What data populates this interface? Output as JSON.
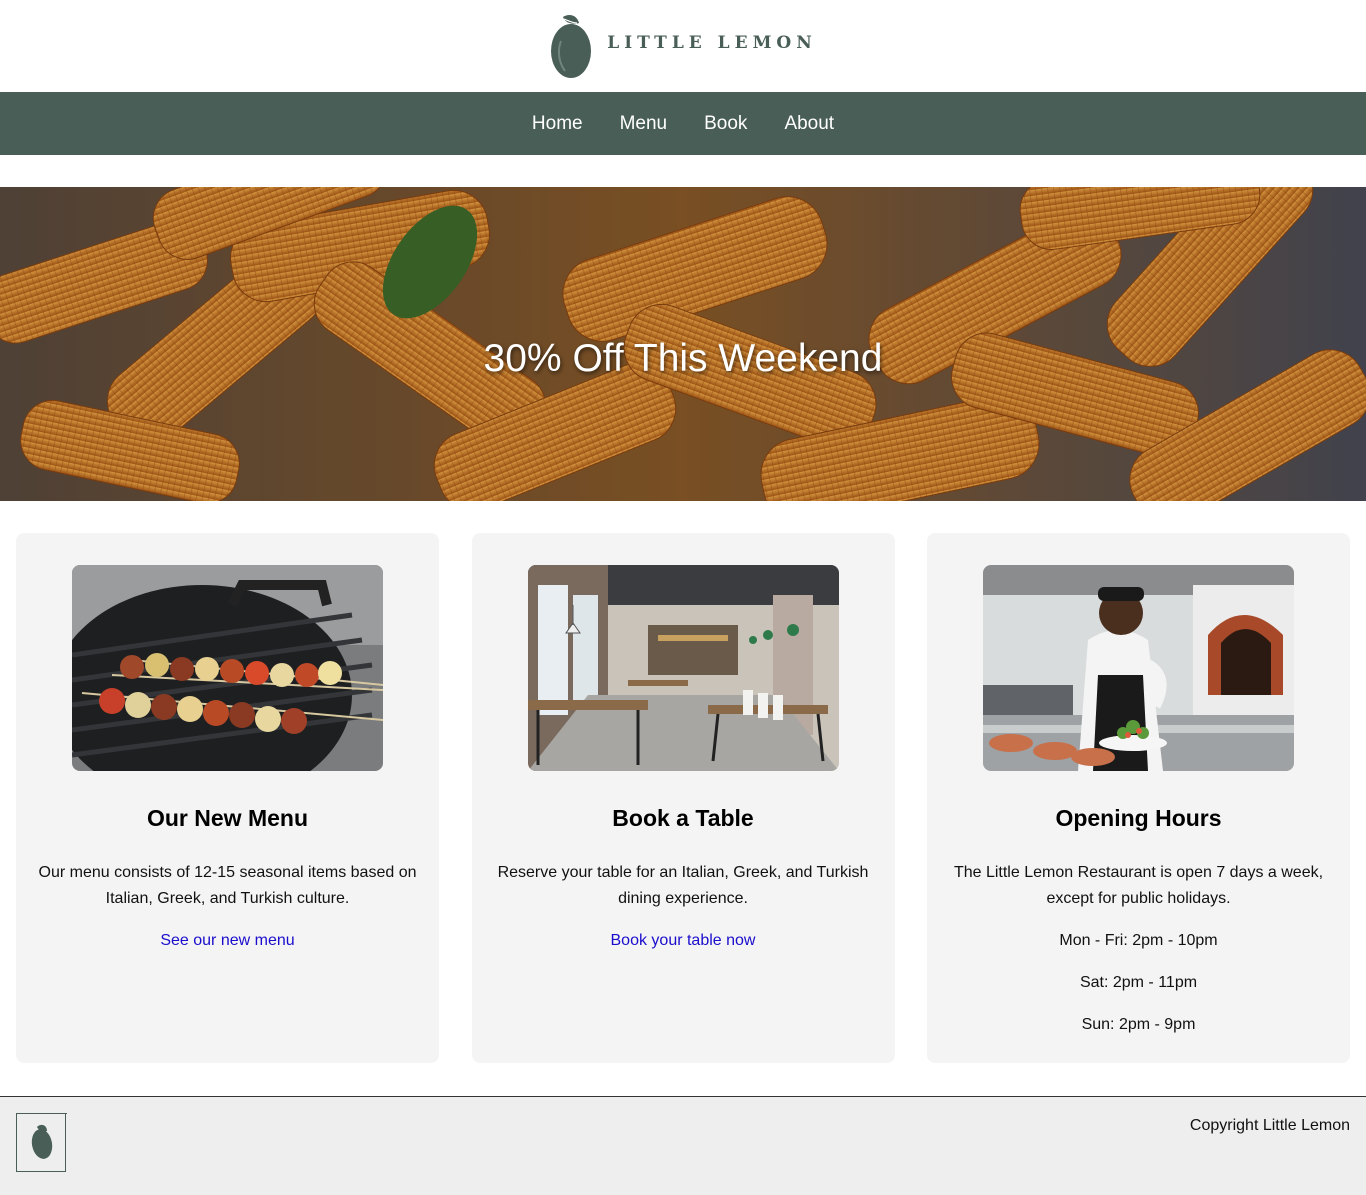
{
  "brand": {
    "name": "LITTLE LEMON",
    "color": "#495e57"
  },
  "nav": {
    "items": [
      {
        "label": "Home"
      },
      {
        "label": "Menu"
      },
      {
        "label": "Book"
      },
      {
        "label": "About"
      }
    ]
  },
  "hero": {
    "title": "30% Off This Weekend"
  },
  "cards": [
    {
      "title": "Our New Menu",
      "description": "Our menu consists of 12-15 seasonal items based on Italian, Greek, and Turkish culture.",
      "link": "See our new menu"
    },
    {
      "title": "Book a Table",
      "description": "Reserve your table for an Italian, Greek, and Turkish dining experience.",
      "link": "Book your table now"
    },
    {
      "title": "Opening Hours",
      "description": "The Little Lemon Restaurant is open 7 days a week, except for public holidays.",
      "hours": [
        "Mon - Fri: 2pm - 10pm",
        "Sat: 2pm - 11pm",
        "Sun: 2pm - 9pm"
      ]
    }
  ],
  "footer": {
    "copyright": "Copyright Little Lemon"
  },
  "colors": {
    "nav_bg": "#495e57",
    "link": "#1a0dcc",
    "card_bg": "#f4f4f4",
    "footer_bg": "#edeeed"
  }
}
